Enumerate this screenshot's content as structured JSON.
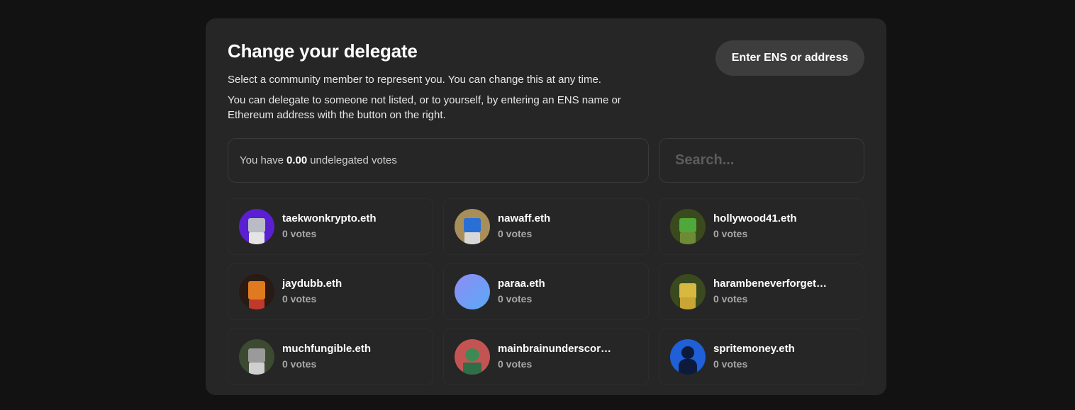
{
  "modal": {
    "title": "Change your delegate",
    "desc1": "Select a community member to represent you. You can change this at any time.",
    "desc2": "You can delegate to someone not listed, or to yourself, by entering an ENS name or Ethereum address with the button on the right.",
    "enter_button": "Enter ENS or address"
  },
  "votes": {
    "prefix": "You have",
    "amount": "0.00",
    "suffix": "undelegated votes"
  },
  "search": {
    "placeholder": "Search..."
  },
  "delegates": [
    {
      "name": "taekwonkrypto.eth",
      "votes": "0 votes",
      "avatar": "purple-robot"
    },
    {
      "name": "nawaff.eth",
      "votes": "0 votes",
      "avatar": "blue-robot"
    },
    {
      "name": "hollywood41.eth",
      "votes": "0 votes",
      "avatar": "green-robot"
    },
    {
      "name": "jaydubb.eth",
      "votes": "0 votes",
      "avatar": "arcade-robot"
    },
    {
      "name": "paraa.eth",
      "votes": "0 votes",
      "avatar": "gradient-circle"
    },
    {
      "name": "harambeneverforget…",
      "votes": "0 votes",
      "avatar": "yellow-robot"
    },
    {
      "name": "muchfungible.eth",
      "votes": "0 votes",
      "avatar": "gray-robot"
    },
    {
      "name": "mainbrainunderscor…",
      "votes": "0 votes",
      "avatar": "red-creature"
    },
    {
      "name": "spritemoney.eth",
      "votes": "0 votes",
      "avatar": "blue-silhouette"
    }
  ],
  "colors": {
    "background": "#121212",
    "panel": "#262626",
    "button": "#3d3d3d"
  }
}
